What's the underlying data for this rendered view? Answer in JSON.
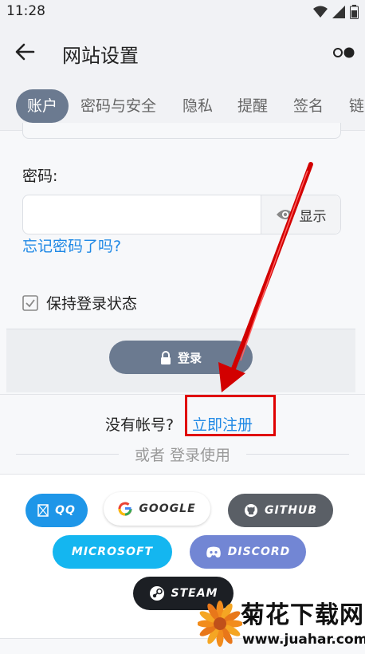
{
  "status_bar": {
    "time": "11:28"
  },
  "app_bar": {
    "title": "网站设置"
  },
  "tabs": [
    {
      "label": "账户",
      "active": true
    },
    {
      "label": "密码与安全"
    },
    {
      "label": "隐私"
    },
    {
      "label": "提醒"
    },
    {
      "label": "签名"
    },
    {
      "label": "链"
    }
  ],
  "form": {
    "password_label": "密码:",
    "password_value": "",
    "show_label": "显示",
    "forgot_link": "忘记密码了吗?",
    "keep_logged_in": "保持登录状态",
    "login_button": "登录"
  },
  "register": {
    "no_account_text": "没有帐号?",
    "register_link": "立即注册",
    "or_text": "或者 登录使用"
  },
  "social_buttons": {
    "qq": "QQ",
    "google": "GOOGLE",
    "github": "GITHUB",
    "microsoft": "MICROSOFT",
    "discord": "DISCORD",
    "steam": "STEAM"
  },
  "watermark": {
    "title": "菊花下载网",
    "url": "www.juahar.com"
  },
  "colors": {
    "accent": "#6b7a90",
    "link": "#1e88e5",
    "highlight": "#e00000",
    "qq": "#1e96e8",
    "github": "#5a5f66",
    "microsoft": "#14b6f0",
    "discord": "#7286d4",
    "steam": "#1c1f24"
  }
}
